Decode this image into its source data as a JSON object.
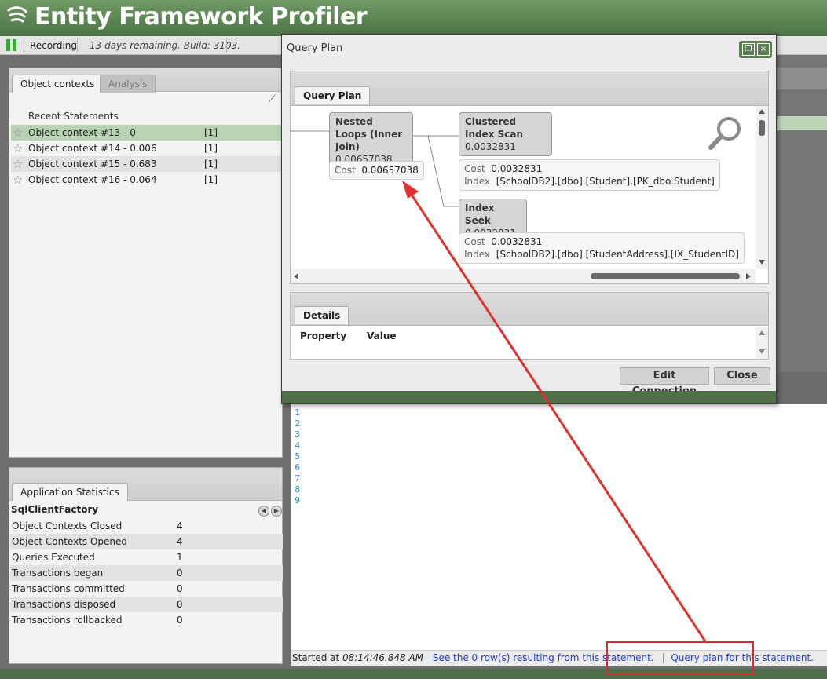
{
  "app": {
    "title": "Entity Framework Profiler",
    "accent_color": "#5b8a52"
  },
  "toolbar": {
    "pause_icon": "pause-icon",
    "recording_label": "Recording",
    "remaining_text": "13 days remaining.  Build: 3103."
  },
  "left_panel": {
    "tabs": [
      {
        "label": "Object contexts",
        "active": true
      },
      {
        "label": "Analysis",
        "active": false
      }
    ],
    "recent_header": "Recent Statements",
    "contexts": [
      {
        "name": "Object context #13  - 0",
        "count": "[1]",
        "selected": true
      },
      {
        "name": "Object context #14  - 0.006",
        "count": "[1]",
        "selected": false
      },
      {
        "name": "Object context #15  - 0.683",
        "count": "[1]",
        "selected": false
      },
      {
        "name": "Object context #16  - 0.064",
        "count": "[1]",
        "selected": false
      }
    ]
  },
  "stats_panel": {
    "tab_label": "Application Statistics",
    "factory": "SqlClientFactory",
    "rows": [
      {
        "label": "Object Contexts Closed",
        "value": "4"
      },
      {
        "label": "Object Contexts Opened",
        "value": "4"
      },
      {
        "label": "Queries Executed",
        "value": "1"
      },
      {
        "label": "Transactions began",
        "value": "0"
      },
      {
        "label": "Transactions committed",
        "value": "0"
      },
      {
        "label": "Transactions disposed",
        "value": "0"
      },
      {
        "label": "Transactions rollbacked",
        "value": "0"
      }
    ]
  },
  "modal": {
    "title": "Query Plan",
    "plan_tab": "Query Plan",
    "nodes": {
      "nested_loops": {
        "title": "Nested Loops (Inner Join)",
        "value": "0.00657038",
        "cost_label": "Cost",
        "cost": "0.00657038"
      },
      "clustered": {
        "title": "Clustered Index Scan",
        "value": "0.0032831",
        "cost_label": "Cost",
        "cost": "0.0032831",
        "index_label": "Index",
        "index": "[SchoolDB2].[dbo].[Student].[PK_dbo.Student]"
      },
      "seek": {
        "title": "Index Seek",
        "value": "0.0032831",
        "cost_label": "Cost",
        "cost": "0.0032831",
        "index_label": "Index",
        "index": "[SchoolDB2].[dbo].[StudentAddress].[IX_StudentID]"
      }
    },
    "details_tab": "Details",
    "details_cols": [
      "Property",
      "Value"
    ],
    "edit_button": "Edit Connection",
    "close_button": "Close"
  },
  "sql": {
    "line_numbers": [
      "1",
      "2",
      "3",
      "4",
      "5",
      "6",
      "7",
      "8",
      "9"
    ]
  },
  "statusbar": {
    "started_prefix": "Started at ",
    "time": "08:14:46.848 AM",
    "rows_link": "See the 0 row(s) resulting from this statement.",
    "plan_link": "Query plan for this statement."
  }
}
